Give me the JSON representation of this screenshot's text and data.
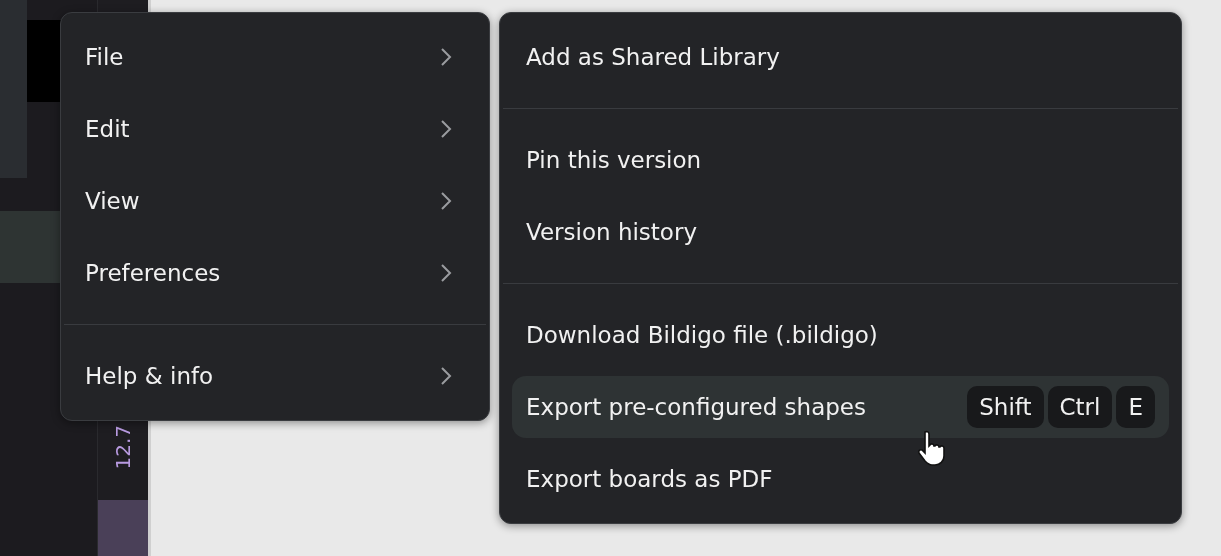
{
  "side_panel": {
    "value": "12.7"
  },
  "main_menu": {
    "sections": [
      [
        {
          "label": "File",
          "submenu": true,
          "selected": false
        },
        {
          "label": "Edit",
          "submenu": true,
          "selected": false
        },
        {
          "label": "View",
          "submenu": true,
          "selected": false
        },
        {
          "label": "Preferences",
          "submenu": true,
          "selected": false
        }
      ],
      [
        {
          "label": "Help & info",
          "submenu": true,
          "selected": false
        }
      ]
    ]
  },
  "file_submenu": {
    "sections": [
      [
        {
          "label": "Add as Shared Library",
          "selected": false
        }
      ],
      [
        {
          "label": "Pin this version",
          "selected": false
        },
        {
          "label": "Version history",
          "selected": false
        }
      ],
      [
        {
          "label": "Download Bildigo file (.bildigo)",
          "selected": false
        },
        {
          "label": "Export pre-configured shapes",
          "selected": true,
          "shortcut": [
            "Shift",
            "Ctrl",
            "E"
          ]
        },
        {
          "label": "Export boards as PDF",
          "selected": false
        }
      ]
    ]
  }
}
